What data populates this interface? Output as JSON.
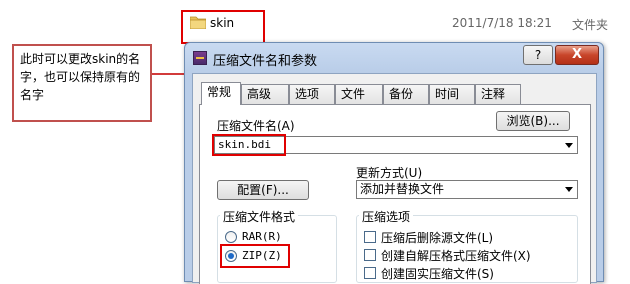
{
  "explorer": {
    "folder_name": "skin",
    "folder_date": "2011/7/18 18:21",
    "folder_type": "文件夹"
  },
  "callout": {
    "text": "此时可以更改skin的名字，也可以保持原有的名字"
  },
  "dialog": {
    "title": "压缩文件名和参数",
    "help_label": "?",
    "close_label": "X",
    "tabs": [
      "常规",
      "高级",
      "选项",
      "文件",
      "备份",
      "时间",
      "注释"
    ],
    "archive_name_label": "压缩文件名(A)",
    "browse_label": "浏览(B)...",
    "archive_name_value": "skin.bdi",
    "update_mode_label": "更新方式(U)",
    "update_mode_value": "添加并替换文件",
    "config_label": "配置(F)...",
    "format_group_label": "压缩文件格式",
    "format_rar": "RAR(R)",
    "format_zip": "ZIP(Z)",
    "options_group_label": "压缩选项",
    "option_1": "压缩后删除源文件(L)",
    "option_2": "创建自解压格式压缩文件(X)",
    "option_3": "创建固实压缩文件(S)"
  },
  "colors": {
    "highlight_border": "#e00000",
    "callout_border": "#c0504d",
    "title_bar": "#b9cde8"
  }
}
